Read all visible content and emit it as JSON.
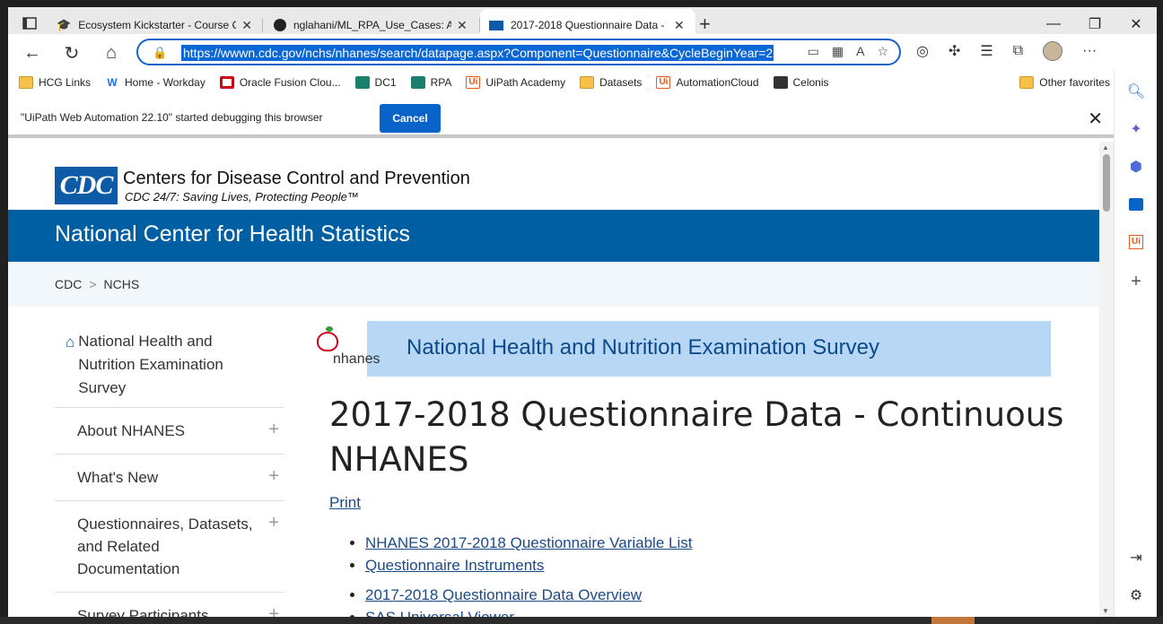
{
  "tabs": [
    {
      "title": "Ecosystem Kickstarter - Course C",
      "close": "✕"
    },
    {
      "title": "nglahani/ML_RPA_Use_Cases: A c",
      "close": "✕"
    },
    {
      "title": "2017-2018 Questionnaire Data -",
      "close": "✕"
    }
  ],
  "new_tab": "+",
  "window_controls": {
    "minimize": "—",
    "maximize": "❐",
    "close": "✕"
  },
  "address_bar": {
    "url": "https://wwwn.cdc.gov/nchs/nhanes/search/datapage.aspx?Component=Questionnaire&CycleBeginYear=2"
  },
  "favorites": [
    {
      "label": "HCG Links",
      "icon": "folder-icon"
    },
    {
      "label": "Home - Workday",
      "icon": "workday-icon"
    },
    {
      "label": "Oracle Fusion Clou...",
      "icon": "oracle-icon"
    },
    {
      "label": "DC1",
      "icon": "dc-icon"
    },
    {
      "label": "RPA",
      "icon": "dc-icon"
    },
    {
      "label": "UiPath Academy",
      "icon": "uipath-icon"
    },
    {
      "label": "Datasets",
      "icon": "folder-icon"
    },
    {
      "label": "AutomationCloud",
      "icon": "uipath-icon"
    },
    {
      "label": "Celonis",
      "icon": "celonis-icon"
    }
  ],
  "other_favorites": "Other favorites",
  "infobar": {
    "message": "\"UiPath Web Automation 22.10\" started debugging this browser",
    "cancel": "Cancel"
  },
  "cdc": {
    "logo_text": "CDC",
    "name": "Centers for Disease Control and Prevention",
    "tagline": "CDC 24/7: Saving Lives, Protecting People™"
  },
  "nchs_title": "National Center for Health Statistics",
  "breadcrumb": {
    "root": "CDC",
    "sep": ">",
    "current": "NCHS"
  },
  "leftnav": {
    "home": "National Health and Nutrition Examination Survey",
    "items": [
      "About NHANES",
      "What's New",
      "Questionnaires, Datasets, and Related Documentation",
      "Survey Participants"
    ]
  },
  "banner": {
    "logo_text": "nhanes",
    "title": "National Health and Nutrition Examination Survey"
  },
  "page_title": "2017-2018 Questionnaire Data - Continuous NHANES",
  "print": "Print",
  "links": [
    "NHANES 2017-2018 Questionnaire Variable List",
    "Questionnaire Instruments",
    "2017-2018 Questionnaire Data Overview",
    "SAS Universal Viewer"
  ]
}
